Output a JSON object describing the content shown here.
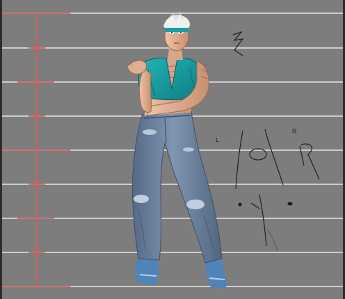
{
  "canvas": {
    "name": "figure-painting-canvas",
    "background": "#7d7d7d",
    "guide_line_color": "#e6e6e6",
    "ruler_color": "#e05555"
  },
  "palette": {
    "top": "#17a3a6",
    "top_shadow": "#0d6e73",
    "jeans": "#6f86a3",
    "jeans_shadow": "#4c5f79",
    "jeans_highlight": "#aab9cc",
    "skin": "#e7b69a",
    "skin_shadow": "#b98366",
    "hair": "#eeeeee",
    "headband": "#19a0a4",
    "shoes": "#4f84b8",
    "sketch_ink": "#1e1e1e"
  },
  "annotations": {
    "left_mark": "L",
    "right_mark": "R"
  }
}
